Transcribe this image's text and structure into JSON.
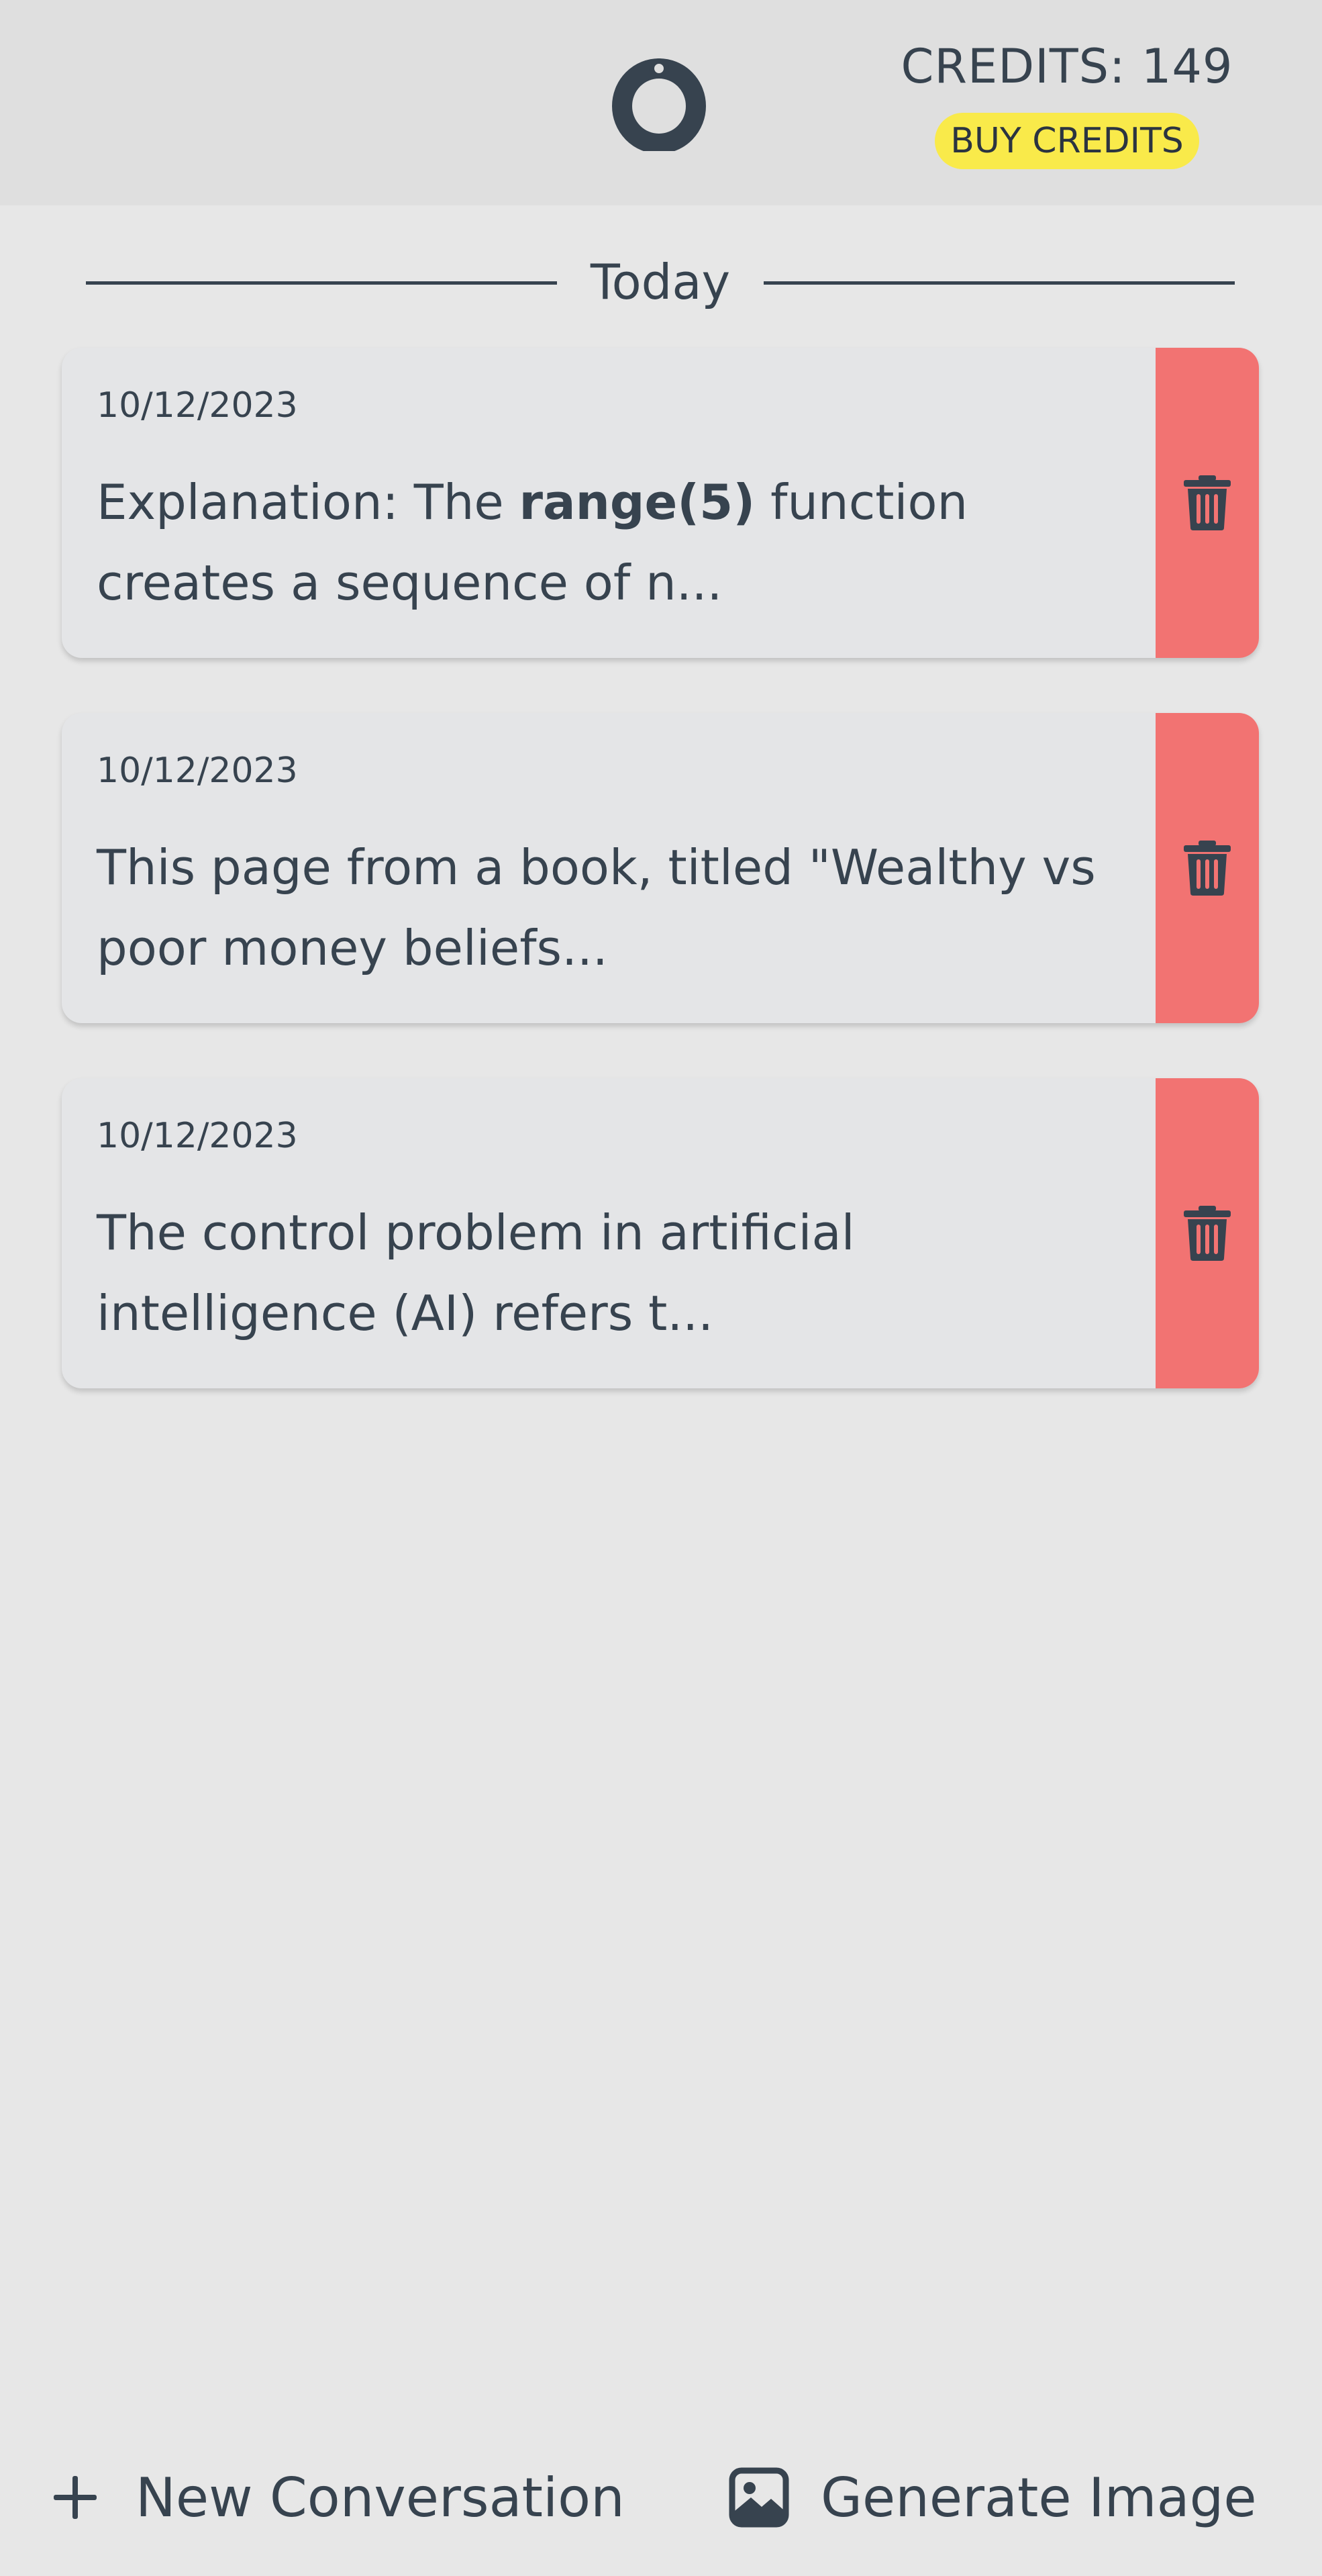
{
  "header": {
    "credits_text": "CREDITS: 149",
    "buy_label": "BUY CREDITS",
    "logo_icon": "ring-logo-icon",
    "buy_color": "#f9ea4a"
  },
  "section": {
    "label": "Today"
  },
  "conversations": [
    {
      "date": "10/12/2023",
      "preview_before": "Explanation: The ",
      "preview_bold": "range(5)",
      "preview_after": " function creates a sequence of n...",
      "delete_icon": "trash-icon"
    },
    {
      "date": "10/12/2023",
      "preview": "This page from a book, titled \"Wealthy vs poor money beliefs...",
      "delete_icon": "trash-icon"
    },
    {
      "date": "10/12/2023",
      "preview": "The control problem in artificial intelligence (AI) refers t...",
      "delete_icon": "trash-icon"
    }
  ],
  "footer": {
    "new_conversation_label": "New Conversation",
    "new_conversation_icon": "plus-icon",
    "generate_image_label": "Generate Image",
    "generate_image_icon": "image-icon"
  },
  "colors": {
    "delete": "#f27372",
    "text": "#37434f",
    "background": "#e7e7e7"
  }
}
